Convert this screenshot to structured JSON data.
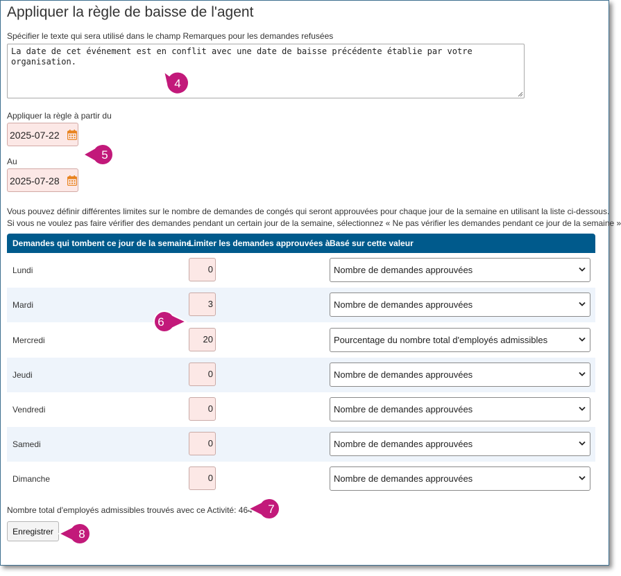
{
  "page": {
    "title": "Appliquer la règle de baisse de l'agent",
    "remarks_label": "Spécifier le texte qui sera utilisé dans le champ Remarques pour les demandes refusées",
    "remarks_value": "La date de cet événement est en conflit avec une date de baisse précédente établie par votre organisation.",
    "from_label": "Appliquer la règle à partir du",
    "from_value": "2025-07-22",
    "to_label": "Au",
    "to_value": "2025-07-28",
    "info_line1": "Vous pouvez définir différentes limites sur le nombre de demandes de congés qui seront approuvées pour chaque jour de la semaine en utilisant la liste ci-dessous.",
    "info_line2": "Si vous ne voulez pas faire vérifier des demandes pendant un certain jour de la semaine, sélectionnez « Ne pas vérifier les demandes pendant ce jour de la semaine »",
    "total_text": "Nombre total d'employés admissibles trouvés avec ce Activité: 464",
    "save_label": "Enregistrer"
  },
  "table": {
    "headers": [
      "Demandes qui tombent ce jour de la semaine",
      "Limiter les demandes approuvées à",
      "Basé sur cette valeur"
    ],
    "rows": [
      {
        "day": "Lundi",
        "limit": "0",
        "basis": "Nombre de demandes approuvées"
      },
      {
        "day": "Mardi",
        "limit": "3",
        "basis": "Nombre de demandes approuvées"
      },
      {
        "day": "Mercredi",
        "limit": "20",
        "basis": "Pourcentage du nombre total d'employés admissibles"
      },
      {
        "day": "Jeudi",
        "limit": "0",
        "basis": "Nombre de demandes approuvées"
      },
      {
        "day": "Vendredi",
        "limit": "0",
        "basis": "Nombre de demandes approuvées"
      },
      {
        "day": "Samedi",
        "limit": "0",
        "basis": "Nombre de demandes approuvées"
      },
      {
        "day": "Dimanche",
        "limit": "0",
        "basis": "Nombre de demandes approuvées"
      }
    ]
  },
  "callouts": [
    "4",
    "5",
    "6",
    "7",
    "8"
  ],
  "icons": {
    "calendar": "calendar-icon",
    "dropdown": "chevron-down-icon",
    "resize": "resize-grip-icon"
  },
  "colors": {
    "header_bg": "#005a8c",
    "input_bg": "#fce8e6",
    "alt_row": "#eef4fb",
    "callout": "#c2197a",
    "calendar_icon": "#e8831f"
  }
}
